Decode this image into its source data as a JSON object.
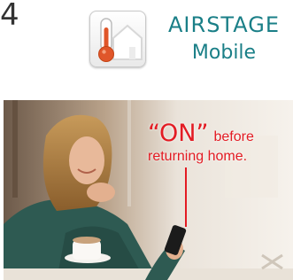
{
  "header": {
    "corner_text": "4",
    "app_icon": "thermometer-house-icon"
  },
  "brand": {
    "name": "AIRSTAGE",
    "sub": "Mobile",
    "color": "#1a7f87"
  },
  "callout": {
    "on_text": "“ON”",
    "before_text": "before",
    "line2": "returning home.",
    "color": "#e31b23"
  },
  "photo": {
    "subject": "woman-using-smartphone-photo"
  }
}
